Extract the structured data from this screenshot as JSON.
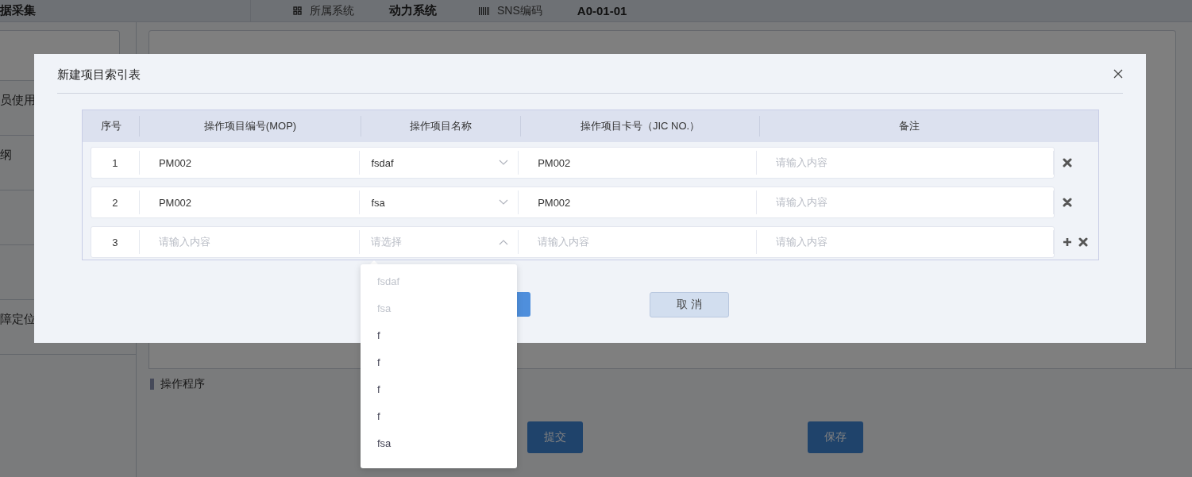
{
  "page": {
    "header": {
      "title": "据采集",
      "items": [
        {
          "kind": "grid",
          "label": "所属系统",
          "value": "动力系统"
        },
        {
          "kind": "barcode",
          "label": "SNS编码",
          "value": "A0-01-01"
        }
      ]
    },
    "sidebar": {
      "items": [
        "员使用",
        "纲",
        "障定位"
      ]
    },
    "section_title": "操作程序",
    "buttons": [
      "提交",
      "保存"
    ]
  },
  "dialog": {
    "title": "新建项目索引表",
    "columns": [
      "序号",
      "操作项目编号(MOP)",
      "操作项目名称",
      "操作项目卡号（JIC NO.）",
      "备注"
    ],
    "rows": [
      {
        "index": "1",
        "mop": {
          "value": "PM002"
        },
        "name": {
          "value": "fsdaf",
          "expanded": false
        },
        "card": {
          "value": "PM002"
        },
        "note": {
          "placeholder": "请输入内容"
        },
        "actions": [
          {
            "kind": "remove"
          }
        ]
      },
      {
        "index": "2",
        "mop": {
          "value": "PM002"
        },
        "name": {
          "value": "fsa",
          "expanded": false
        },
        "card": {
          "value": "PM002"
        },
        "note": {
          "placeholder": "请输入内容"
        },
        "actions": [
          {
            "kind": "remove"
          }
        ]
      },
      {
        "index": "3",
        "mop": {
          "placeholder": "请输入内容"
        },
        "name": {
          "placeholder": "请选择",
          "expanded": true
        },
        "card": {
          "placeholder": "请输入内容"
        },
        "note": {
          "placeholder": "请输入内容"
        },
        "actions": [
          {
            "kind": "add"
          },
          {
            "kind": "remove"
          }
        ]
      }
    ],
    "cancel_button": "取 消",
    "dropdown": [
      {
        "label": "fsdaf",
        "disabled": true
      },
      {
        "label": "fsa",
        "disabled": true
      },
      {
        "label": "f",
        "disabled": false
      },
      {
        "label": "f",
        "disabled": false
      },
      {
        "label": "f",
        "disabled": false
      },
      {
        "label": "f",
        "disabled": false
      },
      {
        "label": "fsa",
        "disabled": false
      }
    ]
  }
}
